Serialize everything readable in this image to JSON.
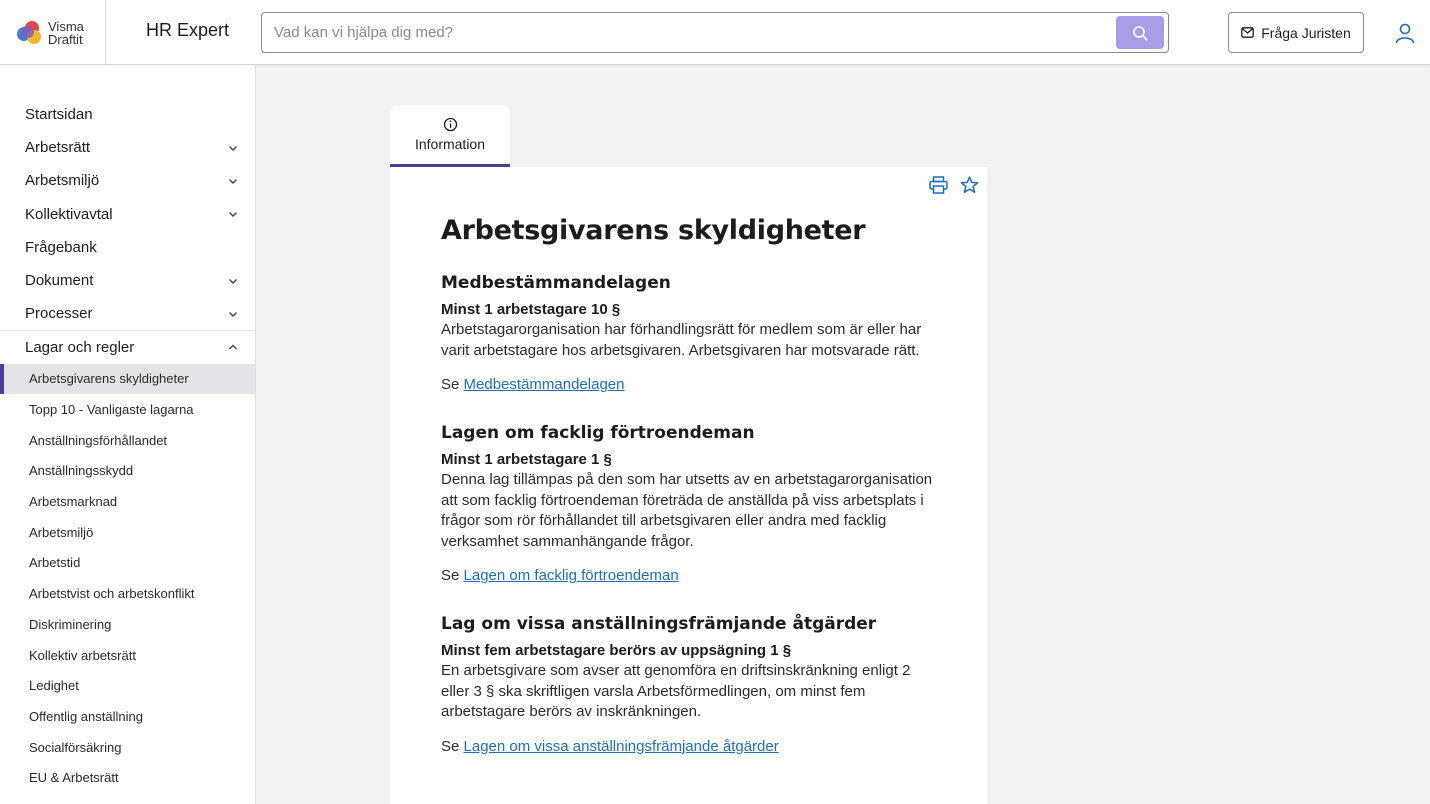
{
  "header": {
    "logo_line1": "Visma",
    "logo_line2": "Draftit",
    "app_title": "HR Expert",
    "search_placeholder": "Vad kan vi hjälpa dig med?",
    "ask_button": "Fråga Juristen"
  },
  "sidebar": {
    "items": [
      {
        "label": "Startsidan",
        "chevron": false
      },
      {
        "label": "Arbetsrätt",
        "chevron": true
      },
      {
        "label": "Arbetsmiljö",
        "chevron": true
      },
      {
        "label": "Kollektivavtal",
        "chevron": true
      },
      {
        "label": "Frågebank",
        "chevron": false
      },
      {
        "label": "Dokument",
        "chevron": true
      },
      {
        "label": "Processer",
        "chevron": true
      }
    ],
    "open_item": "Lagar och regler",
    "sub_items": [
      "Arbetsgivarens skyldigheter",
      "Topp 10 - Vanligaste lagarna",
      "Anställningsförhållandet",
      "Anställningsskydd",
      "Arbetsmarknad",
      "Arbetsmiljö",
      "Arbetstid",
      "Arbetstvist och arbetskonflikt",
      "Diskriminering",
      "Kollektiv arbetsrätt",
      "Ledighet",
      "Offentlig anställning",
      "Socialförsäkring",
      "EU & Arbetsrätt"
    ],
    "active_sub_index": 0
  },
  "tab": {
    "label": "Information"
  },
  "article": {
    "title": "Arbetsgivarens skyldigheter",
    "see_prefix": "Se",
    "sections": [
      {
        "heading": "Medbestämmandelagen",
        "subheading": "Minst 1 arbetstagare 10 §",
        "body": "Arbetstagarorganisation har förhandlingsrätt för medlem som är eller har varit arbetstagare hos arbetsgivaren. Arbetsgivaren har motsvarade rätt.",
        "link": "Medbestämmandelagen"
      },
      {
        "heading": "Lagen om facklig förtroendeman",
        "subheading": "Minst 1 arbetstagare 1 §",
        "body": "Denna lag tillämpas på den som har utsetts av en arbetstagarorganisation att som facklig förtroendeman företräda de anställda på viss arbetsplats i frågor som rör förhållandet till arbetsgivaren eller andra med facklig verksamhet sammanhängande frågor.",
        "link": "Lagen om facklig förtroendeman"
      },
      {
        "heading": "Lag om vissa anställningsfrämjande åtgärder",
        "subheading": "Minst fem arbetstagare berörs av uppsägning 1 §",
        "body": "En arbetsgivare som avser att genomföra en driftsinskränkning enligt 2 eller 3 § ska skriftligen varsla Arbetsförmedlingen, om minst fem arbetstagare berörs av inskränkningen.",
        "link": "Lagen om vissa anställningsfrämjande åtgärder"
      }
    ]
  },
  "colors": {
    "accent": "#4b3d9a",
    "search_button": "#a99de8",
    "link": "#1f6fb8",
    "icon_blue": "#1f6fb8"
  }
}
